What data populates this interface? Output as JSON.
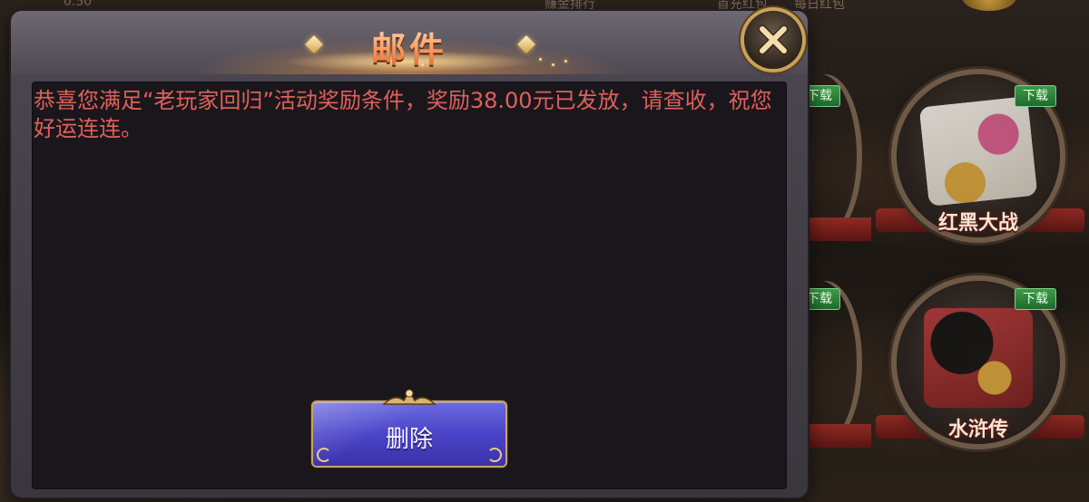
{
  "background": {
    "top_score": "0.50",
    "top_tabs": [
      "赚金排行",
      "首充红包",
      "每日红包"
    ],
    "games": [
      {
        "title": "红黑大战",
        "badge": "下载"
      },
      {
        "title": "水浒传",
        "badge": "下载"
      }
    ],
    "edge_badges": [
      "下载",
      "下载"
    ]
  },
  "dialog": {
    "title": "邮件",
    "close_icon": "close-x-icon",
    "message": "恭喜您满足“老玩家回归”活动奖励条件，奖励38.00元已发放，请查收，祝您好运连连。",
    "delete_label": "删除"
  },
  "colors": {
    "message_text": "#e0605a",
    "title": "#ffb17a",
    "delete_button": "#4a44c8",
    "gold_trim": "#c9a25a"
  }
}
